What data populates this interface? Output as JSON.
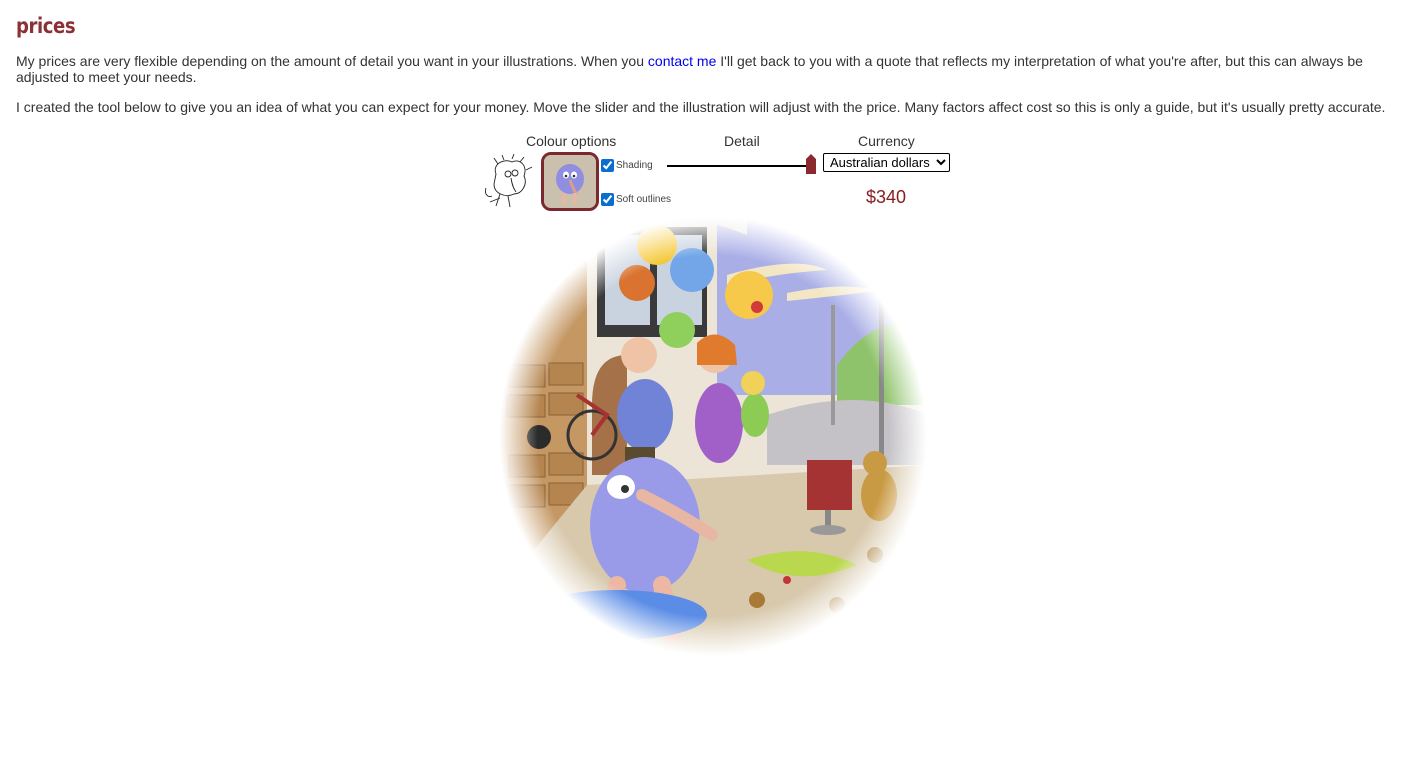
{
  "page": {
    "title": "prices",
    "intro_before_link": "My prices are very flexible depending on the amount of detail you want in your illustrations. When you ",
    "intro_link": "contact me",
    "intro_after_link": " I'll get back to you with a quote that reflects my interpretation of what you're after, but this can always be adjusted to meet your needs.",
    "tool_text": "I created the tool below to give you an idea of what you can expect for your money. Move the slider and the illustration will adjust with the price. Many factors affect cost so this is only a guide, but it's usually pretty accurate."
  },
  "tool": {
    "colour_header": "Colour options",
    "detail_header": "Detail",
    "currency_header": "Currency",
    "shading_label": "Shading",
    "shading_checked": true,
    "soft_outlines_label": "Soft outlines",
    "soft_outlines_checked": true,
    "detail_level": 1.0,
    "currency_selected": "Australian dollars",
    "price": "$340"
  },
  "colors": {
    "title": "#8b3135",
    "price": "#8b1c20",
    "link": "#0000ee",
    "selected_border": "#7a2a2e"
  },
  "icons": [
    "sketch-thumbnail",
    "colour-thumbnail",
    "slider-thumb",
    "illustration"
  ]
}
